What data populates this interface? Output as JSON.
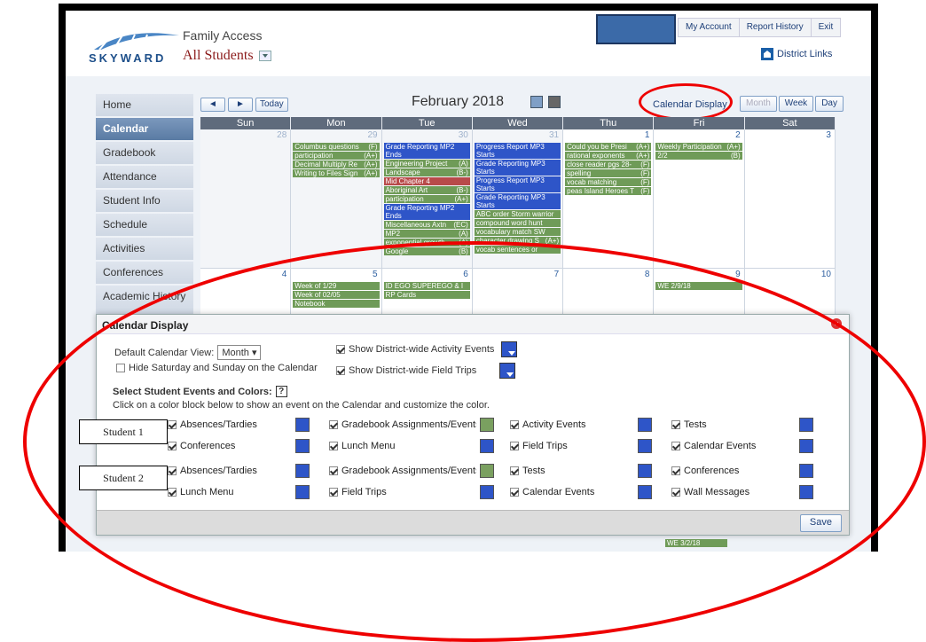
{
  "header": {
    "app_title": "Family Access",
    "logo_text": "SKYWARD",
    "student_select": "All Students",
    "top_links": [
      "My Account",
      "Report History",
      "Exit"
    ],
    "district_links": "District Links"
  },
  "sidebar": {
    "items": [
      {
        "label": "Home",
        "active": false
      },
      {
        "label": "Calendar",
        "active": true
      },
      {
        "label": "Gradebook",
        "active": false
      },
      {
        "label": "Attendance",
        "active": false
      },
      {
        "label": "Student Info",
        "active": false
      },
      {
        "label": "Schedule",
        "active": false
      },
      {
        "label": "Activities",
        "active": false
      },
      {
        "label": "Conferences",
        "active": false
      },
      {
        "label": "Academic History",
        "active": false
      }
    ]
  },
  "calendar": {
    "nav": {
      "prev": "◄",
      "next": "►",
      "today": "Today"
    },
    "title": "February 2018",
    "display_link": "Calendar Display",
    "views": [
      {
        "label": "Month",
        "disabled": true
      },
      {
        "label": "Week",
        "disabled": false
      },
      {
        "label": "Day",
        "disabled": false
      }
    ],
    "days_of_week": [
      "Sun",
      "Mon",
      "Tue",
      "Wed",
      "Thu",
      "Fri",
      "Sat"
    ],
    "week1": [
      {
        "num": "28",
        "other": true,
        "events": []
      },
      {
        "num": "29",
        "other": true,
        "events": [
          {
            "t": "Columbus questions",
            "g": "(F)",
            "c": "g"
          },
          {
            "t": "participation",
            "g": "(A+)",
            "c": "g"
          },
          {
            "t": "Decimal Multiply Re",
            "g": "(A+)",
            "c": "g"
          },
          {
            "t": "Writing to Files Sign",
            "g": "(A+)",
            "c": "g"
          }
        ]
      },
      {
        "num": "30",
        "other": true,
        "events": [
          {
            "t": "Grade Reporting MP2 Ends",
            "g": "",
            "c": "b"
          },
          {
            "t": "Engineering Project",
            "g": "(A)",
            "c": "g"
          },
          {
            "t": "Landscape",
            "g": "(B-)",
            "c": "g"
          },
          {
            "t": "Mid Chapter 4",
            "g": "",
            "c": "r"
          },
          {
            "t": "Aboriginal Art",
            "g": "(B-)",
            "c": "g"
          },
          {
            "t": "participation",
            "g": "(A+)",
            "c": "g"
          },
          {
            "t": "Grade Reporting MP2 Ends",
            "g": "",
            "c": "b"
          },
          {
            "t": "Miscellaneous Axtn",
            "g": "(EC)",
            "c": "g"
          },
          {
            "t": "MP2",
            "g": "(A)",
            "c": "g"
          },
          {
            "t": "exponential growth",
            "g": "(A)",
            "c": "g"
          },
          {
            "t": "Google",
            "g": "(B)",
            "c": "g"
          }
        ]
      },
      {
        "num": "31",
        "other": true,
        "events": [
          {
            "t": "Progress Report MP3 Starts",
            "g": "",
            "c": "b"
          },
          {
            "t": "Grade Reporting MP3 Starts",
            "g": "",
            "c": "b"
          },
          {
            "t": "Progress Report MP3 Starts",
            "g": "",
            "c": "b"
          },
          {
            "t": "Grade Reporting MP3 Starts",
            "g": "",
            "c": "b"
          },
          {
            "t": "ABC order Storm warrior",
            "g": "",
            "c": "g"
          },
          {
            "t": "compound word hunt",
            "g": "",
            "c": "g"
          },
          {
            "t": "vocabulary match SW",
            "g": "",
            "c": "g"
          },
          {
            "t": "character drawing S",
            "g": "(A+)",
            "c": "g"
          },
          {
            "t": "vocab sentences or",
            "g": "",
            "c": "g"
          }
        ]
      },
      {
        "num": "1",
        "other": false,
        "events": [
          {
            "t": "Could you be Presi",
            "g": "(A+)",
            "c": "g"
          },
          {
            "t": "rational exponents",
            "g": "(A+)",
            "c": "g"
          },
          {
            "t": "close reader pgs 28-",
            "g": "(F)",
            "c": "g"
          },
          {
            "t": "spelling",
            "g": "(F)",
            "c": "g"
          },
          {
            "t": "vocab matching",
            "g": "(F)",
            "c": "g"
          },
          {
            "t": "peas Island Heroes T",
            "g": "(F)",
            "c": "g"
          }
        ]
      },
      {
        "num": "2",
        "other": false,
        "events": [
          {
            "t": "Weekly Participation",
            "g": "(A+)",
            "c": "g"
          },
          {
            "t": "2/2",
            "g": "(B)",
            "c": "g"
          }
        ]
      },
      {
        "num": "3",
        "other": false,
        "events": []
      }
    ],
    "week2": [
      {
        "num": "4",
        "other": false,
        "events": []
      },
      {
        "num": "5",
        "other": false,
        "events": [
          {
            "t": "Week of 1/29",
            "g": "",
            "c": "g"
          },
          {
            "t": "Week of 02/05",
            "g": "",
            "c": "g"
          },
          {
            "t": "Notebook",
            "g": "",
            "c": "g"
          }
        ]
      },
      {
        "num": "6",
        "other": false,
        "events": [
          {
            "t": "ID EGO SUPEREGO & I",
            "g": "",
            "c": "g"
          },
          {
            "t": "RP Cards",
            "g": "",
            "c": "g"
          }
        ]
      },
      {
        "num": "7",
        "other": false,
        "events": []
      },
      {
        "num": "8",
        "other": false,
        "events": []
      },
      {
        "num": "9",
        "other": false,
        "events": [
          {
            "t": "WE 2/9/18",
            "g": "",
            "c": "g"
          }
        ]
      },
      {
        "num": "10",
        "other": false,
        "events": []
      }
    ]
  },
  "display_panel": {
    "title": "Calendar Display",
    "default_view_label": "Default Calendar View:",
    "default_view_value": "Month",
    "hide_weekend_label": "Hide Saturday and Sunday on the Calendar",
    "district_activity_label": "Show District-wide Activity Events",
    "district_field_label": "Show District-wide Field Trips",
    "select_heading": "Select Student Events and Colors:",
    "help": "?",
    "instructions": "Click on a color block below to show an event on the Calendar and customize the color.",
    "students": [
      {
        "label": "Student 1",
        "rows": [
          [
            {
              "label": "Absences/Tardies",
              "color": "blue"
            },
            {
              "label": "Gradebook Assignments/Events",
              "color": "green"
            },
            {
              "label": "Activity Events",
              "color": "blue"
            },
            {
              "label": "Tests",
              "color": "blue"
            }
          ],
          [
            {
              "label": "Conferences",
              "color": "blue"
            },
            {
              "label": "Lunch Menu",
              "color": "blue"
            },
            {
              "label": "Field Trips",
              "color": "blue"
            },
            {
              "label": "Calendar Events",
              "color": "blue"
            }
          ]
        ]
      },
      {
        "label": "Student 2",
        "rows": [
          [
            {
              "label": "Absences/Tardies",
              "color": "blue"
            },
            {
              "label": "Gradebook Assignments/Events",
              "color": "green"
            },
            {
              "label": "Tests",
              "color": "blue"
            },
            {
              "label": "Conferences",
              "color": "blue"
            }
          ],
          [
            {
              "label": "Lunch Menu",
              "color": "blue"
            },
            {
              "label": "Field Trips",
              "color": "blue"
            },
            {
              "label": "Calendar Events",
              "color": "blue"
            },
            {
              "label": "Wall Messages",
              "color": "blue"
            }
          ]
        ]
      }
    ],
    "save": "Save",
    "bottom_event": "WE 3/2/18"
  },
  "colors": {
    "accent": "#2e55c8",
    "grade_green": "#6f9b58",
    "annotation_red": "#e00000"
  }
}
